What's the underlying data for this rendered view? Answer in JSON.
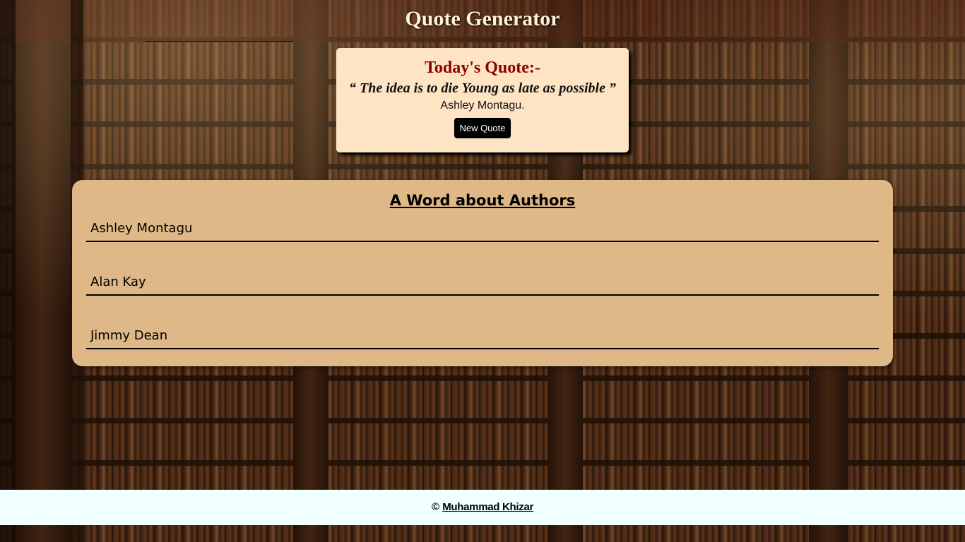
{
  "header": {
    "title": "Quote Generator"
  },
  "quote": {
    "heading": "Today's Quote:-",
    "text": "“ The idea is to die Young as late as possible ”",
    "author": "Ashley Montagu.",
    "button_label": "New Quote"
  },
  "authors": {
    "heading": "A Word about Authors",
    "items": [
      {
        "name": "Ashley Montagu"
      },
      {
        "name": "Alan Kay"
      },
      {
        "name": "Jimmy Dean"
      }
    ]
  },
  "footer": {
    "copyright_symbol": "©",
    "author_link": "Muhammad Khizar"
  },
  "colors": {
    "quote_card_bg": "#ffe4c4",
    "quote_heading": "#8b0000",
    "authors_card_bg": "#deb887",
    "footer_bg": "#f0ffff"
  }
}
